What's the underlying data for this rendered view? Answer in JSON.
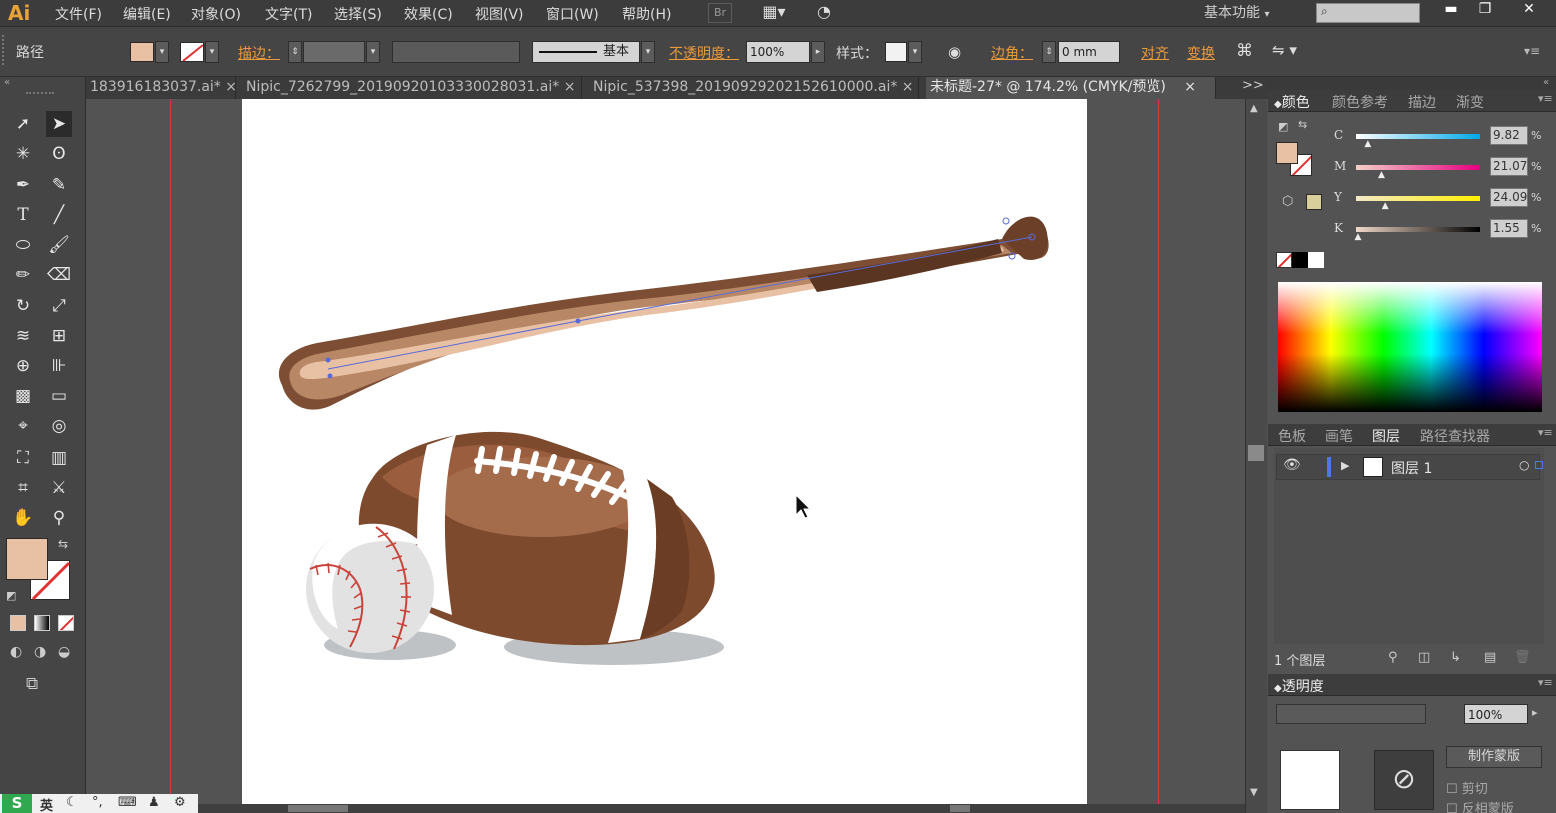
{
  "menubar": {
    "logo": "Ai",
    "items": [
      "文件(F)",
      "编辑(E)",
      "对象(O)",
      "文字(T)",
      "选择(S)",
      "效果(C)",
      "视图(V)",
      "窗口(W)",
      "帮助(H)"
    ],
    "bridge_label": "Br",
    "workspace": "基本功能",
    "search_placeholder": ""
  },
  "controlbar": {
    "selection_type": "路径",
    "stroke_label": "描边：",
    "stroke_style": "基本",
    "opacity_label": "不透明度：",
    "opacity_value": "100%",
    "style_label": "样式：",
    "corner_label": "边角：",
    "corner_value": "0 mm",
    "align_label": "对齐",
    "transform_label": "变换",
    "fill_color": "#e8c1a4"
  },
  "tabs": [
    {
      "label": "183916183037.ai*",
      "close": "×"
    },
    {
      "label": "Nipic_7262799_20190920103330028031.ai*",
      "close": "×"
    },
    {
      "label": "Nipic_537398_20190929202152610000.ai*",
      "close": "×"
    },
    {
      "label": "未标题-27* @ 174.2% (CMYK/预览)",
      "close": "×"
    }
  ],
  "tab_overflow": ">>",
  "color_panel": {
    "tabs": [
      "颜色",
      "颜色参考",
      "描边",
      "渐变"
    ],
    "channels": [
      {
        "name": "C",
        "value": "9.82",
        "unit": "%",
        "level": 0.1
      },
      {
        "name": "M",
        "value": "21.07",
        "unit": "%",
        "level": 0.21
      },
      {
        "name": "Y",
        "value": "24.09",
        "unit": "%",
        "level": 0.24
      },
      {
        "name": "K",
        "value": "1.55",
        "unit": "%",
        "level": 0.02
      }
    ],
    "fill_color": "#e8c1a4",
    "oog_color": "#d8cf9a"
  },
  "layers_panel": {
    "tabs": [
      "色板",
      "画笔",
      "图层",
      "路径查找器"
    ],
    "layer_name": "图层 1",
    "layer_count": "1 个图层"
  },
  "transparency_panel": {
    "title": "透明度",
    "opacity": "100%",
    "mask_button": "制作蒙版",
    "clip_label": "剪切",
    "invert_label": "反相蒙版"
  },
  "ime": {
    "label": "英"
  }
}
